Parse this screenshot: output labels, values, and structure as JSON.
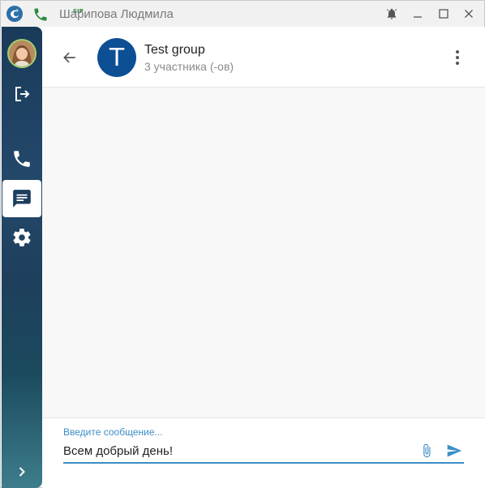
{
  "window": {
    "title": "Шарипова Людмила",
    "sip_badge": "SIP"
  },
  "sidebar": {
    "items": [
      {
        "name": "logout",
        "icon": "logout-icon"
      },
      {
        "name": "calls",
        "icon": "phone-icon"
      },
      {
        "name": "chats",
        "icon": "chat-icon",
        "active": true
      },
      {
        "name": "settings",
        "icon": "gear-icon"
      }
    ],
    "expand_icon": "chevron-right-icon"
  },
  "chat": {
    "avatar_letter": "T",
    "name": "Test group",
    "members": "3 участника (-ов)"
  },
  "composer": {
    "label": "Введите сообщение...",
    "value": "Всем добрый день!"
  },
  "colors": {
    "accent": "#3c8dc6",
    "group_avatar": "#0d4f95",
    "sidebar_top": "#1a3a5a",
    "sidebar_bottom": "#3d7d8c",
    "sip_green": "#2e8b3e"
  }
}
